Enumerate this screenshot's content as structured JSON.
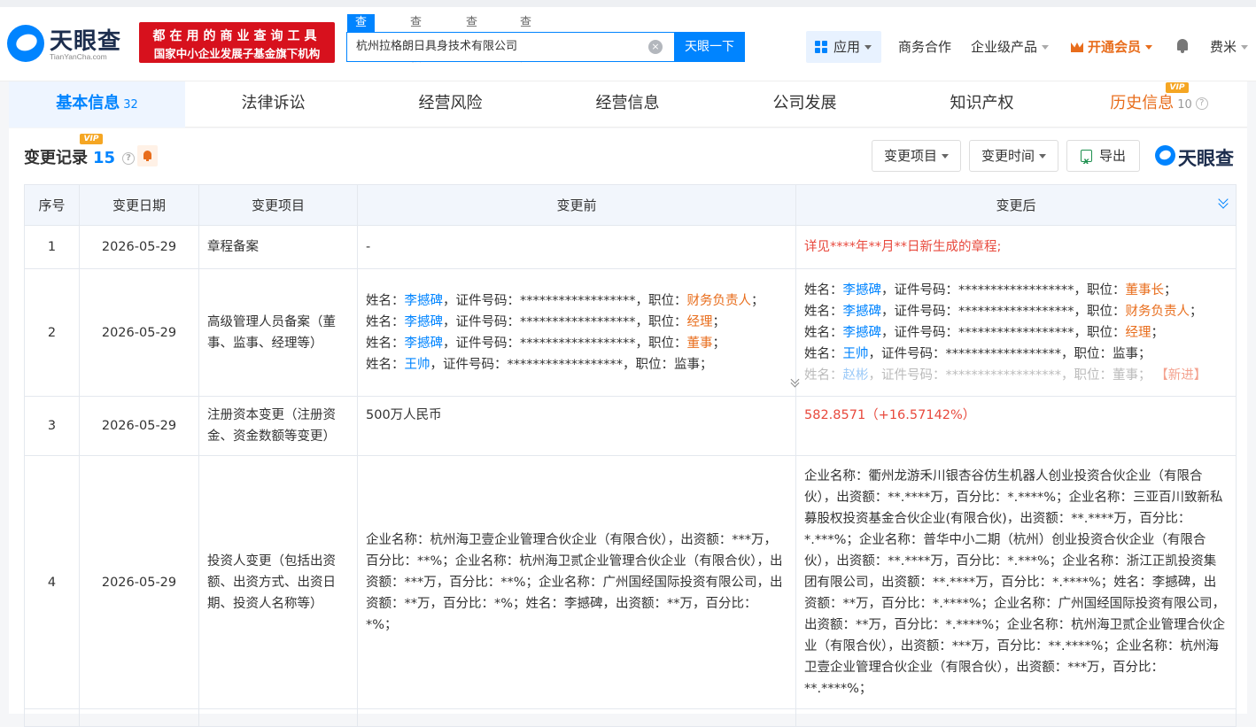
{
  "brand": {
    "logo_text": "天眼查",
    "logo_sub": "TianYanCha.com",
    "promo_line1": "都在用的商业查询工具",
    "promo_line2": "国家中小企业发展子基金旗下机构"
  },
  "search": {
    "tabs": [
      "查公司",
      "查老板",
      "查关系",
      "查风险"
    ],
    "value": "杭州拉格朗日具身技术有限公司",
    "button": "天眼一下"
  },
  "nav": {
    "app": "应用",
    "business": "商务合作",
    "enterprise": "企业级产品",
    "vip": "开通会员",
    "user": "费米"
  },
  "tabs": [
    {
      "label": "基本信息",
      "count": "32"
    },
    {
      "label": "法律诉讼"
    },
    {
      "label": "经营风险"
    },
    {
      "label": "经营信息"
    },
    {
      "label": "公司发展"
    },
    {
      "label": "知识产权"
    },
    {
      "label": "历史信息",
      "count": "10"
    }
  ],
  "section": {
    "title": "变更记录",
    "count": "15",
    "vip": "VIP",
    "filter_item": "变更项目",
    "filter_time": "变更时间",
    "export": "导出",
    "brand": "天眼查"
  },
  "table": {
    "headers": [
      "序号",
      "变更日期",
      "变更项目",
      "变更前",
      "变更后"
    ],
    "rows": [
      {
        "index": "1",
        "date": "2026-05-29",
        "item": "章程备案",
        "before": "-",
        "after": "详见****年**月**日新生成的章程;"
      },
      {
        "index": "2",
        "date": "2026-05-29",
        "item": "高级管理人员备案（董事、监事、经理等）",
        "before": [
          {
            "name": "李撼碑",
            "id": "******************",
            "role": "财务负责人",
            "end": "；"
          },
          {
            "name": "李撼碑",
            "id": "******************",
            "role": "经理",
            "end": "；"
          },
          {
            "name": "李撼碑",
            "id": "******************",
            "role": "董事",
            "end": "；"
          },
          {
            "name": "王帅",
            "id": "******************",
            "role": "监事",
            "end": "；"
          }
        ],
        "after": [
          {
            "name": "李撼碑",
            "id": "******************",
            "role": "董事长",
            "end": "；"
          },
          {
            "name": "李撼碑",
            "id": "******************",
            "role": "财务负责人",
            "end": "；"
          },
          {
            "name": "李撼碑",
            "id": "******************",
            "role": "经理",
            "end": "；"
          },
          {
            "name": "王帅",
            "id": "******************",
            "role": "监事",
            "end": "；"
          },
          {
            "name": "赵彬",
            "id": "******************",
            "role": "董事",
            "end": "；",
            "tag": "【新进】"
          }
        ]
      },
      {
        "index": "3",
        "date": "2026-05-29",
        "item": "注册资本变更（注册资金、资金数额等变更）",
        "before": "500万人民币",
        "after": "582.8571（+16.57142%）"
      },
      {
        "index": "4",
        "date": "2026-05-29",
        "item": "投资人变更（包括出资额、出资方式、出资日期、投资人名称等）",
        "before": "企业名称：杭州海卫壹企业管理合伙企业（有限合伙），出资额：***万，百分比：**%；企业名称：杭州海卫贰企业管理合伙企业（有限合伙），出资额：***万，百分比：**%；企业名称：广州国经国际投资有限公司，出资额：**万，百分比：*%；姓名：李撼碑，出资额：**万，百分比：*%；",
        "after": "企业名称：衢州龙游禾川银杏谷仿生机器人创业投资合伙企业（有限合伙），出资额：**.****万，百分比：*.****%；企业名称：三亚百川致新私募股权投资基金合伙企业(有限合伙)，出资额：**.****万，百分比：*.***%；企业名称：普华中小二期（杭州）创业投资合伙企业（有限合伙），出资额：**.****万，百分比：*.***%；企业名称：浙江正凯投资集团有限公司，出资额：**.****万，百分比：*.****%；姓名：李撼碑，出资额：**万，百分比：*.****%；企业名称：广州国经国际投资有限公司，出资额：**万，百分比：*.****%；企业名称：杭州海卫贰企业管理合伙企业（有限合伙），出资额：***万，百分比：**.****%；企业名称：杭州海卫壹企业管理合伙企业（有限合伙），出资额：***万，百分比：**.****%；"
      }
    ],
    "labels": {
      "name": "姓名：",
      "id": "，证件号码：",
      "role": "，职位："
    }
  }
}
